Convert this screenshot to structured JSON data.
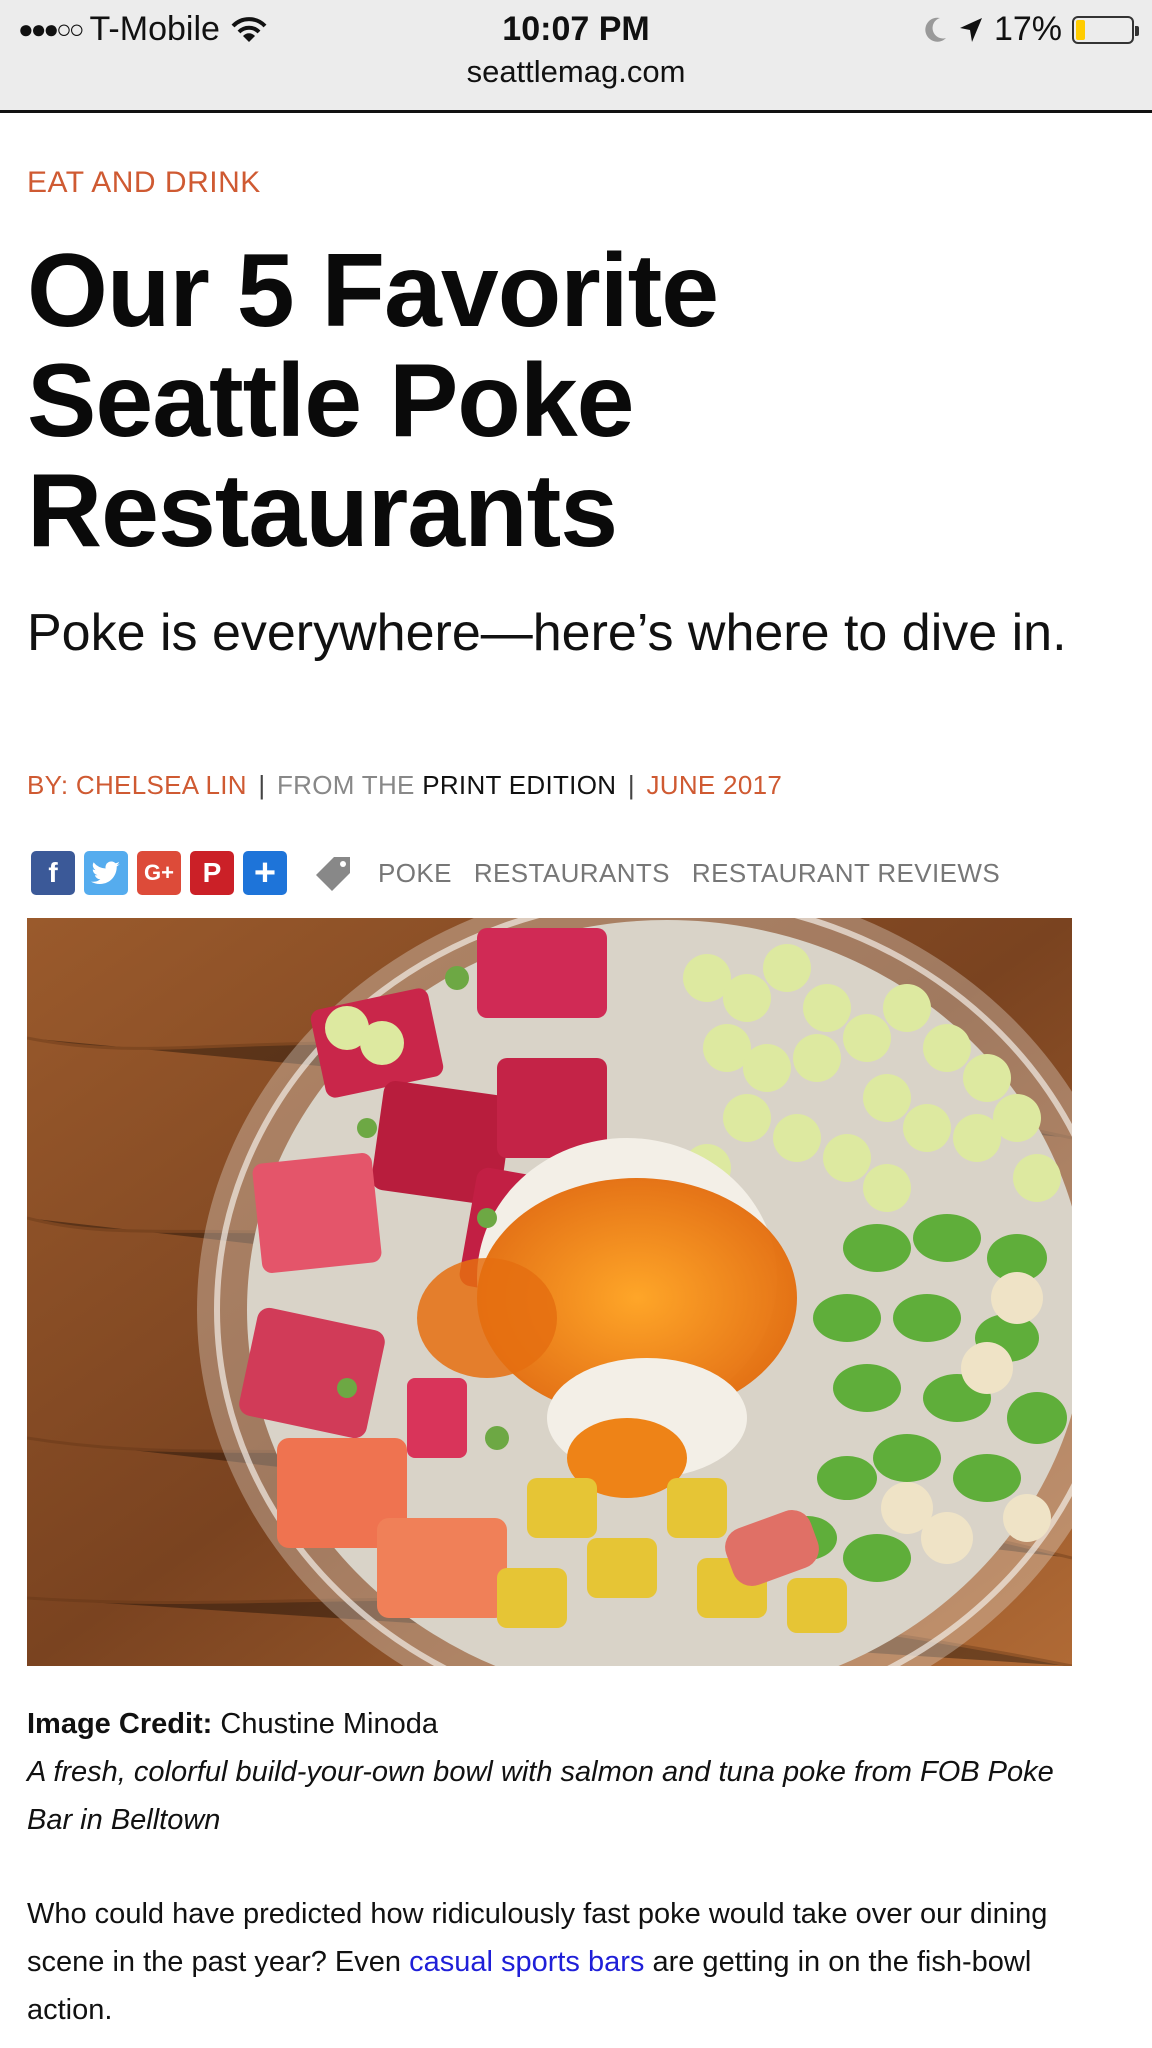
{
  "status_bar": {
    "signal": "●●●○○",
    "carrier": "T-Mobile",
    "time": "10:07 PM",
    "battery_percent": "17%",
    "battery_level": 0.17,
    "url": "seattlemag.com"
  },
  "article": {
    "category": "EAT AND DRINK",
    "headline_line1": "Our 5 Favorite",
    "headline_line2": "Seattle Poke",
    "headline_line3": "Restaurants",
    "dek": "Poke is everywhere—here’s where to dive in.",
    "byline": {
      "by_label": "BY:",
      "author": "CHELSEA LIN",
      "from_label": "FROM THE",
      "edition": "PRINT EDITION",
      "date": "JUNE 2017"
    },
    "share_buttons": [
      {
        "name": "facebook",
        "glyph": "f",
        "color": "#3b5998"
      },
      {
        "name": "twitter",
        "glyph": "t",
        "color": "#55acee"
      },
      {
        "name": "google-plus",
        "glyph": "G+",
        "color": "#dd4b39"
      },
      {
        "name": "pinterest",
        "glyph": "P",
        "color": "#cb2027"
      },
      {
        "name": "addthis",
        "glyph": "+",
        "color": "#1e74d9"
      }
    ],
    "tags": [
      "POKE",
      "RESTAURANTS",
      "RESTAURANT REVIEWS"
    ],
    "image_credit_label": "Image Credit:",
    "image_credit": "Chustine Minoda",
    "caption": "A fresh, colorful build-your-own bowl with salmon and tuna poke from FOB Poke Bar in Belltown",
    "body_before": "Who could have predicted how ridiculously fast poke would take over our dining scene in the past year? Even ",
    "body_link": "casual sports bars",
    "body_after": " are getting in on the fish-bowl action."
  }
}
